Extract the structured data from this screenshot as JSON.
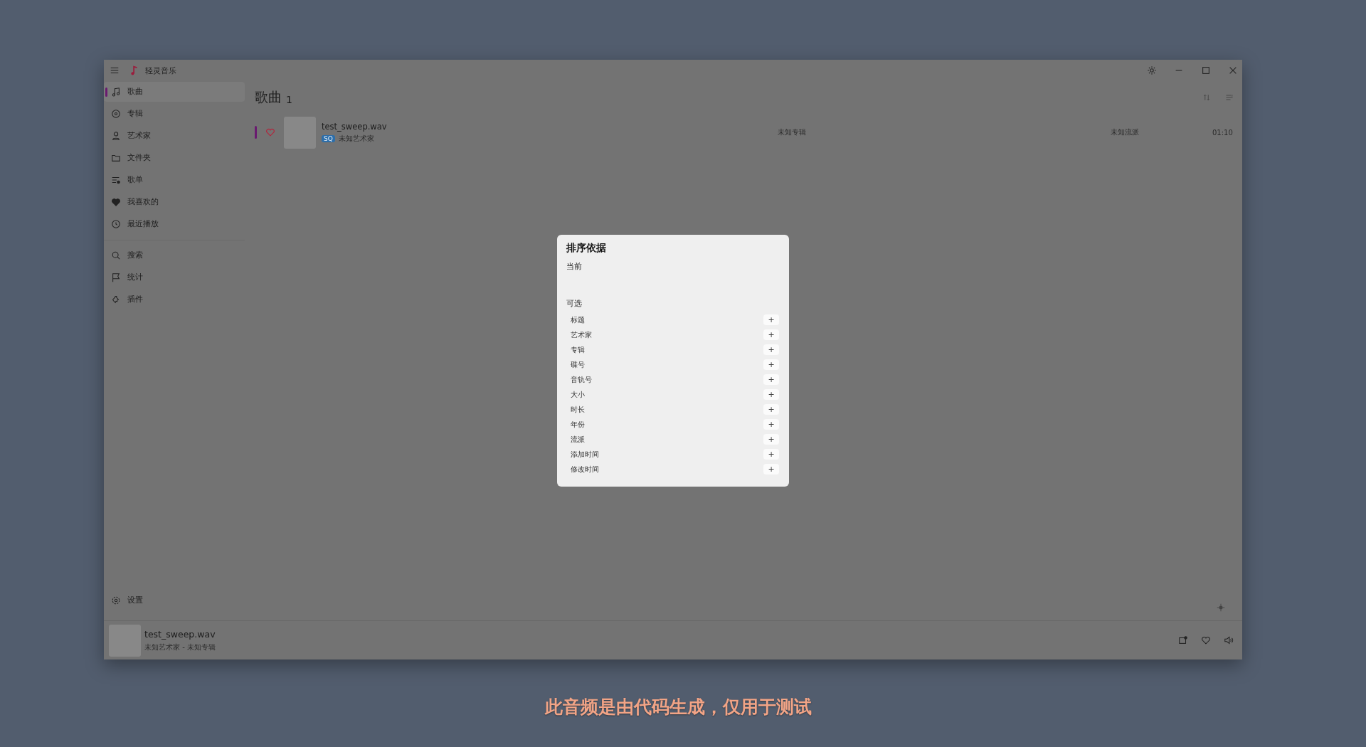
{
  "app": {
    "title": "轻灵音乐"
  },
  "sidebar": {
    "groups": [
      {
        "items": [
          {
            "label": "歌曲",
            "selected": true
          },
          {
            "label": "专辑",
            "selected": false
          },
          {
            "label": "艺术家",
            "selected": false
          },
          {
            "label": "文件夹",
            "selected": false
          },
          {
            "label": "歌单",
            "selected": false
          },
          {
            "label": "我喜欢的",
            "selected": false
          },
          {
            "label": "最近播放",
            "selected": false
          }
        ]
      },
      {
        "items": [
          {
            "label": "搜索",
            "selected": false
          },
          {
            "label": "统计",
            "selected": false
          },
          {
            "label": "插件",
            "selected": false
          }
        ]
      }
    ],
    "footer": {
      "label": "设置"
    }
  },
  "page": {
    "title": "歌曲",
    "count": "1"
  },
  "songs": [
    {
      "title": "test_sweep.wav",
      "quality": "SQ",
      "artist": "未知艺术家",
      "album": "未知专辑",
      "genre": "未知流派",
      "duration": "01:10",
      "liked": false,
      "playing": true
    }
  ],
  "dialog": {
    "title": "排序依据",
    "current_label": "当前",
    "available_label": "可选",
    "options": [
      {
        "label": "标题",
        "button": "+"
      },
      {
        "label": "艺术家",
        "button": "+"
      },
      {
        "label": "专辑",
        "button": "+"
      },
      {
        "label": "碟号",
        "button": "+"
      },
      {
        "label": "音轨号",
        "button": "+"
      },
      {
        "label": "大小",
        "button": "+"
      },
      {
        "label": "时长",
        "button": "+"
      },
      {
        "label": "年份",
        "button": "+"
      },
      {
        "label": "流派",
        "button": "+"
      },
      {
        "label": "添加时间",
        "button": "+"
      },
      {
        "label": "修改时间",
        "button": "+"
      }
    ]
  },
  "player": {
    "title": "test_sweep.wav",
    "subtitle": "未知艺术家 - 未知专辑"
  },
  "caption": "此音频是由代码生成，仅用于测试"
}
